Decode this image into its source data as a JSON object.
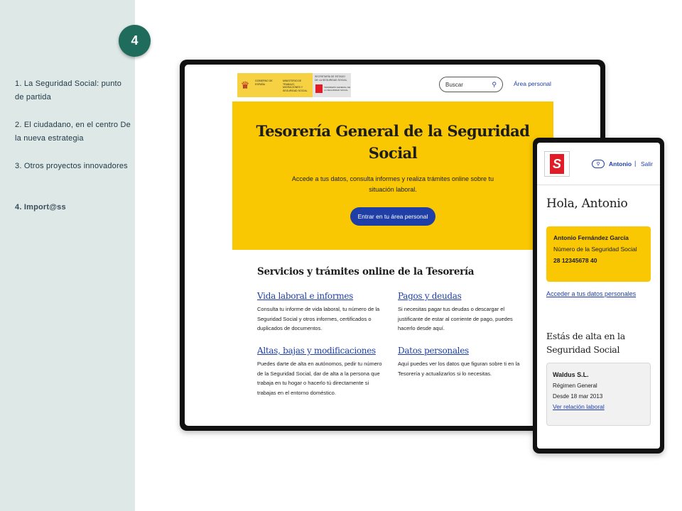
{
  "slide_number": "4",
  "sidebar": {
    "items": [
      {
        "label": "1. La Seguridad Social: punto de partida"
      },
      {
        "label": "2. El ciudadano, en el centro De la nueva estrategia"
      },
      {
        "label": "3. Otros proyectos innovadores"
      },
      {
        "label": "4. Import@ss"
      }
    ]
  },
  "tablet": {
    "header": {
      "gov_line1": "GOBIERNO DE ESPAÑA",
      "gov_line2": "MINISTERIO DE TRABAJO, MIGRACIONES Y SEGURIDAD SOCIAL",
      "secretaria": "SECRETARÍA DE ESTADO DE LA SEGURIDAD SOCIAL",
      "tgss": "TESORERÍA GENERAL DE LA SEGURIDAD SOCIAL",
      "search_label": "Buscar",
      "area_link": "Área personal"
    },
    "hero": {
      "title": "Tesorería General de la Seguridad Social",
      "subtitle": "Accede a tus datos, consulta informes y realiza trámites online sobre tu situación laboral.",
      "cta": "Entrar en tu área personal"
    },
    "services": {
      "title": "Servicios y trámites online de la Tesorería",
      "items": [
        {
          "link": "Vida laboral e informes",
          "desc": "Consulta tu informe de vida laboral, tu número de la Seguridad Social y otros informes, certificados o duplicados de documentos."
        },
        {
          "link": "Pagos y deudas",
          "desc": "Si necesitas pagar tus deudas o descargar el justificante de estar al corriente de pago, puedes hacerlo desde aquí."
        },
        {
          "link": "Altas, bajas y modificaciones",
          "desc": "Puedes darte de alta en autónomos, pedir tu número de la Seguridad Social, dar de alta a la persona que trabaja en tu hogar o hacerlo tú directamente si trabajas en el entorno doméstico."
        },
        {
          "link": "Datos personales",
          "desc": "Aquí puedes ver los datos que figuran sobre ti en la Tesorería y actualizarlos si lo necesitas."
        }
      ]
    }
  },
  "phone": {
    "user": "Antonio",
    "separator": "|",
    "exit": "Salir",
    "greeting": "Hola, Antonio",
    "card": {
      "name": "Antonio Fernández García",
      "ss_label": "Número de la Seguridad Social",
      "ss_number": "28 12345678 40"
    },
    "access_link": "Acceder a tus datos personales",
    "section_title": "Estás de alta en la Seguridad Social",
    "employment": {
      "company": "Waldus S.L.",
      "regime": "Régimen General",
      "since": "Desde 18 mar 2013",
      "link": "Ver relación laboral"
    }
  }
}
